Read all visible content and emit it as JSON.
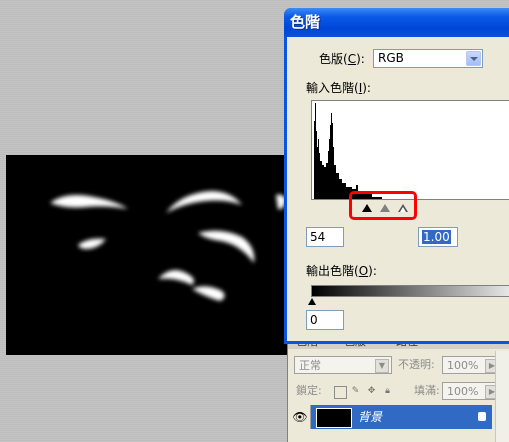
{
  "levels_dialog": {
    "title": "色階",
    "channel_label": "色版(",
    "channel_key": "C",
    "channel_tail": "):",
    "channel_value": "RGB",
    "input_levels_label": "輸入色階(",
    "input_levels_key": "I",
    "input_levels_tail": "):",
    "input_black": "54",
    "input_gamma": "1.00",
    "output_levels_label": "輸出色階(",
    "output_levels_key": "O",
    "output_levels_tail": "):",
    "output_black": "0"
  },
  "layers_panel": {
    "tabs": [
      "色階",
      "色版",
      "路徑"
    ],
    "blend_mode": "正常",
    "opacity_label": "不透明:",
    "opacity_value": "100%",
    "lock_label": "鎖定:",
    "fill_label": "填滿:",
    "fill_value": "100%",
    "layer_name": "背景"
  },
  "colors": {
    "titlebar": "#0a54e0",
    "dialog_face": "#ece9d8",
    "selection": "#316ac5",
    "highlight": "#ff0000"
  },
  "icons": [
    "eye-icon",
    "lock-icon",
    "dropdown-arrow-icon",
    "slider-triangle-icon"
  ]
}
